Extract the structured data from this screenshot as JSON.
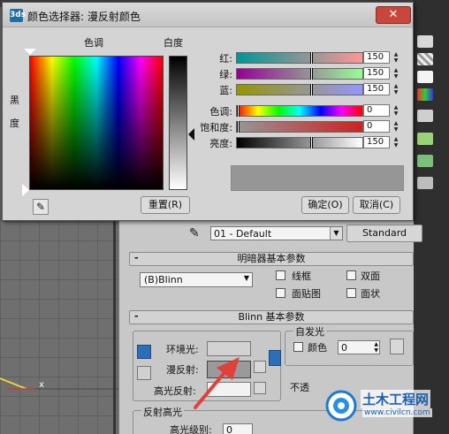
{
  "dialog": {
    "title": "颜色选择器: 漫反射颜色",
    "app_icon": "3ds",
    "close_glyph": "✕",
    "hue_label": "色调",
    "whiteness_label": "白度",
    "blackness_label_1": "黑",
    "blackness_label_2": "度",
    "sliders": [
      {
        "label": "红:",
        "value": "150",
        "level": 0.59
      },
      {
        "label": "绿:",
        "value": "150",
        "level": 0.59
      },
      {
        "label": "蓝:",
        "value": "150",
        "level": 0.59
      },
      {
        "label": "色调:",
        "value": "0",
        "level": 0.0
      },
      {
        "label": "饱和度:",
        "value": "0",
        "level": 0.0
      },
      {
        "label": "亮度:",
        "value": "150",
        "level": 0.59
      }
    ],
    "buttons": {
      "reset": "重置(R)",
      "ok": "确定(O)",
      "cancel": "取消(C)"
    },
    "preview_color": "#969696"
  },
  "material": {
    "material_name": "01 - Default",
    "material_type": "Standard",
    "shader_rollout_title": "明暗器基本参数",
    "shader_value": "(B)Blinn",
    "wire_label": "线框",
    "two_sided_label": "双面",
    "face_map_label": "面贴图",
    "faceted_label": "面状",
    "blinn_rollout_title": "Blinn 基本参数",
    "self_illum_label": "自发光",
    "color_label": "颜色",
    "self_illum_value": "0",
    "ambient_label": "环境光:",
    "diffuse_label": "漫反射:",
    "specular_label": "高光反射:",
    "opacity_label": "不透",
    "spec_highlight_label": "反射高光",
    "spec_level_label": "高光级别:",
    "spec_level_value": "0"
  },
  "viewport": {
    "axis_label": "x"
  },
  "watermark": {
    "brand": "土木工程网",
    "url": "www.civilcn.com"
  },
  "colors": {
    "arrow": "#e0413a",
    "preview": "#969696"
  }
}
